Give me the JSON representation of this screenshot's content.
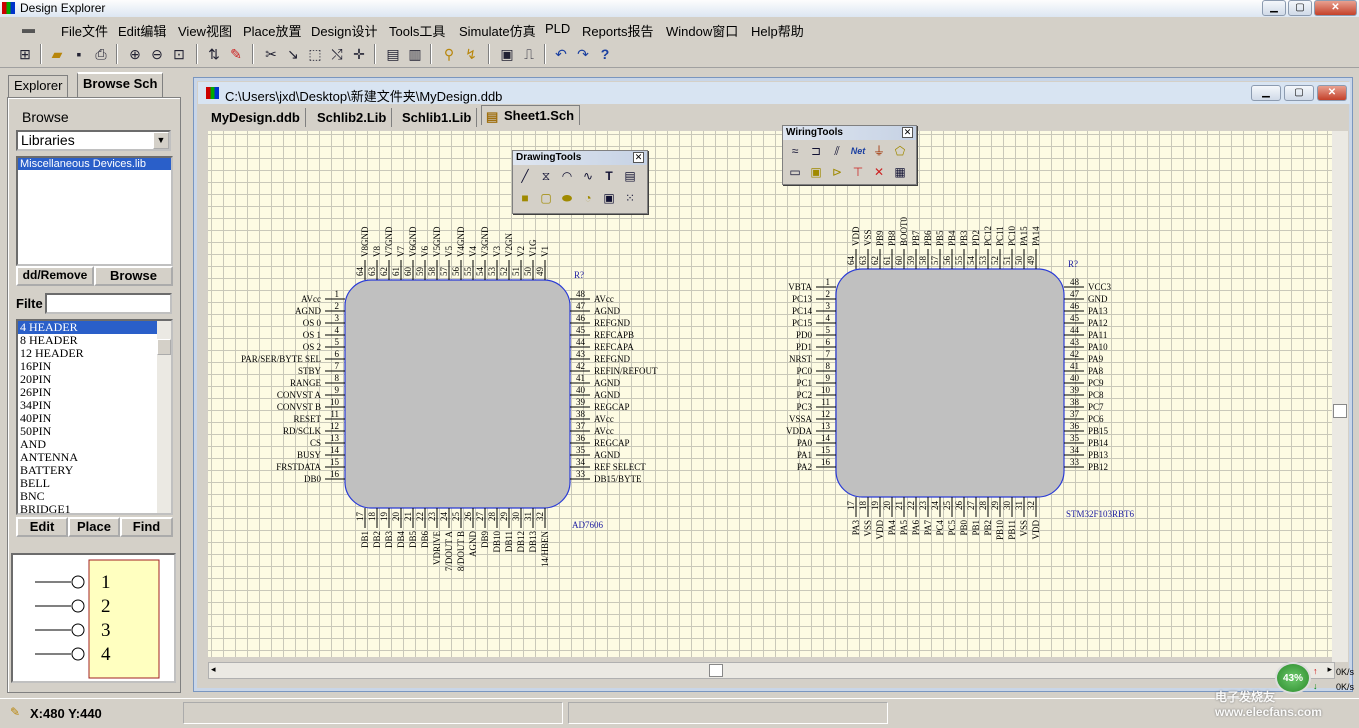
{
  "app": {
    "title": "Design Explorer"
  },
  "menu": [
    "File文件",
    "Edit编辑",
    "View视图",
    "Place放置",
    "Design设计",
    "Tools工具",
    "Simulate仿真",
    "PLD",
    "Reports报告",
    "Window窗口",
    "Help帮助"
  ],
  "left": {
    "tabs": [
      "Explorer",
      "Browse Sch"
    ],
    "browse_label": "Browse",
    "libraries_value": "Libraries",
    "selected_library": "Miscellaneous Devices.lib",
    "add_remove_label": "dd/Remove",
    "browse_button": "Browse",
    "filter_label": "Filte",
    "components": [
      "4 HEADER",
      "8 HEADER",
      "12 HEADER",
      "16PIN",
      "20PIN",
      "26PIN",
      "34PIN",
      "40PIN",
      "50PIN",
      "AND",
      "ANTENNA",
      "BATTERY",
      "BELL",
      "BNC",
      "BRIDGE1"
    ],
    "edit_button": "Edit",
    "place_button": "Place",
    "find_button": "Find",
    "preview_pins": [
      "1",
      "2",
      "3",
      "4"
    ]
  },
  "document": {
    "path": "C:\\Users\\jxd\\Desktop\\新建文件夹\\MyDesign.ddb",
    "tabs": [
      "MyDesign.ddb",
      "Schlib2.Lib",
      "Schlib1.Lib",
      "Sheet1.Sch"
    ]
  },
  "drawing_tools": {
    "title": "DrawingTools"
  },
  "wiring_tools": {
    "title": "WiringTools",
    "net_label": "Net"
  },
  "chip1": {
    "designator": "R?",
    "name": "AD7606",
    "top_pins": [
      "64",
      "63",
      "62",
      "61",
      "60",
      "59",
      "58",
      "57",
      "56",
      "55",
      "54",
      "53",
      "52",
      "51",
      "50",
      "49"
    ],
    "top_names": [
      "V8GND",
      "V8",
      "V7GND",
      "V7",
      "V6GND",
      "V6",
      "V5GND",
      "V5",
      "V4GND",
      "V4",
      "V3GND",
      "V3",
      "V2GN",
      "V2",
      "V1G",
      "V1"
    ],
    "left_pins": [
      "1",
      "2",
      "3",
      "4",
      "5",
      "6",
      "7",
      "8",
      "9",
      "10",
      "11",
      "12",
      "13",
      "14",
      "15",
      "16"
    ],
    "left_names": [
      "AVcc",
      "AGND",
      "OS 0",
      "OS 1",
      "OS 2",
      "PAR/SER/BYTE SEL",
      "STBY",
      "RANGE",
      "CONVST A",
      "CONVST B",
      "RESET",
      "RD/SCLK",
      "CS",
      "BUSY",
      "FRSTDATA",
      "DB0"
    ],
    "right_pins": [
      "48",
      "47",
      "46",
      "45",
      "44",
      "43",
      "42",
      "41",
      "40",
      "39",
      "38",
      "37",
      "36",
      "35",
      "34",
      "33"
    ],
    "right_names": [
      "AVcc",
      "AGND",
      "REFGND",
      "REFCAPB",
      "REFCAPA",
      "REFGND",
      "REFIN/REFOUT",
      "AGND",
      "AGND",
      "REGCAP",
      "AVcc",
      "AVcc",
      "REGCAP",
      "AGND",
      "REF SELECT",
      "DB15/BYTE"
    ],
    "bottom_pins": [
      "17",
      "18",
      "19",
      "20",
      "21",
      "22",
      "23",
      "24",
      "25",
      "26",
      "27",
      "28",
      "29",
      "30",
      "31",
      "32"
    ],
    "bottom_names": [
      "DB1",
      "DB2",
      "DB3",
      "DB4",
      "DB5",
      "DB6",
      "VDRIVE",
      "7/DOUT A",
      "8/DOUT B",
      "AGND",
      "DB9",
      "DB10",
      "DB11",
      "DB12",
      "DB13",
      "14/HBEN"
    ]
  },
  "chip2": {
    "designator": "R?",
    "name": "STM32F103RBT6",
    "top_pins": [
      "64",
      "63",
      "62",
      "61",
      "60",
      "59",
      "58",
      "57",
      "56",
      "55",
      "54",
      "53",
      "52",
      "51",
      "50",
      "49"
    ],
    "top_names": [
      "VDD",
      "VSS",
      "PB9",
      "PB8",
      "BOOT0",
      "PB7",
      "PB6",
      "PB5",
      "PB4",
      "PB3",
      "PD2",
      "PC12",
      "PC11",
      "PC10",
      "PA15",
      "PA14"
    ],
    "left_pins": [
      "1",
      "2",
      "3",
      "4",
      "5",
      "6",
      "7",
      "8",
      "9",
      "10",
      "11",
      "12",
      "13",
      "14",
      "15",
      "16"
    ],
    "left_names": [
      "VBTA",
      "PC13",
      "PC14",
      "PC15",
      "PD0",
      "PD1",
      "NRST",
      "PC0",
      "PC1",
      "PC2",
      "PC3",
      "VSSA",
      "VDDA",
      "PA0",
      "PA1",
      "PA2"
    ],
    "right_pins": [
      "48",
      "47",
      "46",
      "45",
      "44",
      "43",
      "42",
      "41",
      "40",
      "39",
      "38",
      "37",
      "36",
      "35",
      "34",
      "33"
    ],
    "right_names": [
      "VCC3",
      "GND",
      "PA13",
      "PA12",
      "PA11",
      "PA10",
      "PA9",
      "PA8",
      "PC9",
      "PC8",
      "PC7",
      "PC6",
      "PB15",
      "PB14",
      "PB13",
      "PB12"
    ],
    "bottom_pins": [
      "17",
      "18",
      "19",
      "20",
      "21",
      "22",
      "23",
      "24",
      "25",
      "26",
      "27",
      "28",
      "29",
      "30",
      "31",
      "32"
    ],
    "bottom_names": [
      "PA3",
      "VSS",
      "VDD",
      "PA4",
      "PA5",
      "PA6",
      "PA7",
      "PC4",
      "PC5",
      "PB0",
      "PB1",
      "PB2",
      "PB10",
      "PB11",
      "VSS",
      "VDD"
    ]
  },
  "status": {
    "coords": "X:480 Y:440"
  },
  "netmon": {
    "percent": "43%",
    "up": "0K/s",
    "down": "0K/s"
  },
  "watermark": "电子发烧友 www.elecfans.com",
  "colors": {
    "sheet": "#fdfbe3",
    "chip_body": "#c0c0c0",
    "chip_border": "#2a3bd6",
    "selection": "#2a5fc9"
  }
}
